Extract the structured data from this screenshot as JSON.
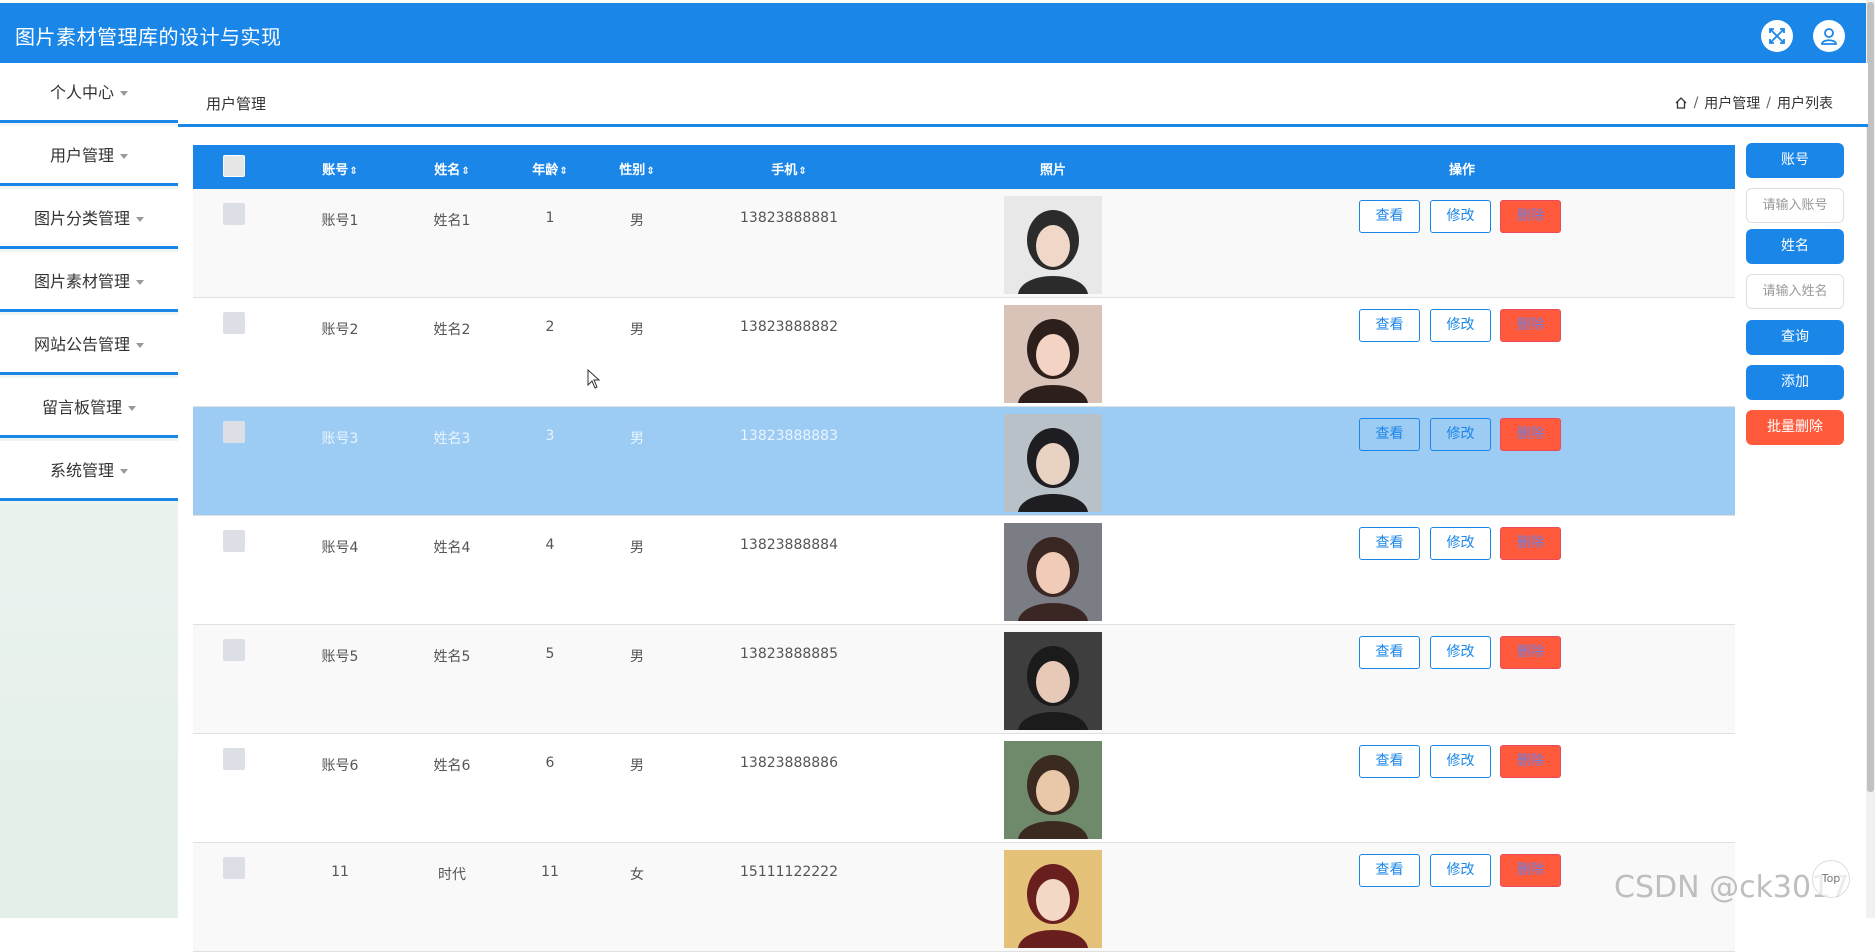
{
  "header": {
    "title": "图片素材管理库的设计与实现"
  },
  "sidebar": {
    "items": [
      {
        "label": "个人中心"
      },
      {
        "label": "用户管理"
      },
      {
        "label": "图片分类管理"
      },
      {
        "label": "图片素材管理"
      },
      {
        "label": "网站公告管理"
      },
      {
        "label": "留言板管理"
      },
      {
        "label": "系统管理"
      }
    ]
  },
  "page": {
    "title": "用户管理"
  },
  "breadcrumb": {
    "items": [
      "用户管理",
      "用户列表"
    ],
    "separator": "/"
  },
  "table": {
    "columns": [
      "账号",
      "姓名",
      "年龄",
      "性别",
      "手机",
      "照片",
      "操作"
    ],
    "sort_icon": "⇕",
    "actions": {
      "view": "查看",
      "edit": "修改",
      "delete": "删除"
    },
    "rows": [
      {
        "account": "账号1",
        "name": "姓名1",
        "age": "1",
        "gender": "男",
        "phone": "13823888881"
      },
      {
        "account": "账号2",
        "name": "姓名2",
        "age": "2",
        "gender": "男",
        "phone": "13823888882"
      },
      {
        "account": "账号3",
        "name": "姓名3",
        "age": "3",
        "gender": "男",
        "phone": "13823888883"
      },
      {
        "account": "账号4",
        "name": "姓名4",
        "age": "4",
        "gender": "男",
        "phone": "13823888884"
      },
      {
        "account": "账号5",
        "name": "姓名5",
        "age": "5",
        "gender": "男",
        "phone": "13823888885"
      },
      {
        "account": "账号6",
        "name": "姓名6",
        "age": "6",
        "gender": "男",
        "phone": "13823888886"
      },
      {
        "account": "11",
        "name": "时代",
        "age": "11",
        "gender": "女",
        "phone": "15111122222"
      }
    ]
  },
  "search": {
    "account_label": "账号",
    "account_placeholder": "请输入账号",
    "name_label": "姓名",
    "name_placeholder": "请输入姓名",
    "query_button": "查询",
    "add_button": "添加",
    "batch_delete_button": "批量删除"
  },
  "watermark": "CSDN @ck3017",
  "back_to_top": "Top",
  "colors": {
    "primary": "#1a86e8",
    "danger": "#ff5a3c",
    "row_highlight": "#9ccbf4"
  }
}
